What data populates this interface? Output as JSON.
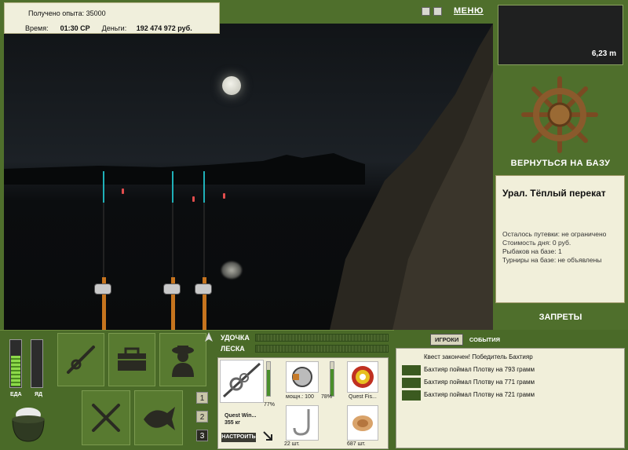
{
  "top": {
    "xp_label": "Получено опыта:",
    "xp_value": "35000",
    "time_label": "Время:",
    "time_value": "01:30 СР",
    "money_label": "Деньги:",
    "money_value": "192 474 972 руб.",
    "menu_label": "МЕНЮ",
    "icons": [
      "pause-icon",
      "sound-icon"
    ]
  },
  "right": {
    "depth": "6,23 m",
    "return_label": "ВЕРНУТЬСЯ НА БАЗУ",
    "location_title": "Урал. Тёплый перекат",
    "location_info": [
      "Осталось путевки: не ограничено",
      "Стоимость дня: 0 руб.",
      "Рыбаков на базе: 1",
      "Турниры на базе: не объявлены"
    ],
    "bans_label": "ЗАПРЕТЫ"
  },
  "bottom": {
    "food_label": "ЕДА",
    "poison_label": "ЯД",
    "food_level": 0.65,
    "poison_level": 0,
    "rod_label": "УДОЧКА",
    "line_label": "ЛЕСКА",
    "slots": [
      "1",
      "2",
      "3"
    ],
    "active_slot": "3"
  },
  "tackle": {
    "rod_name": "Quest Win...",
    "rod_weight": "355 кг",
    "rod_percent": "77%",
    "rod_level": 0.77,
    "reel_power": "мощн.: 100",
    "reel_percent": "78%",
    "reel_level": 0.78,
    "line_name": "Quest Fis...",
    "hooks": "22 шт.",
    "bait": "687 шт.",
    "adjust_label": "НАСТРОИТЬ"
  },
  "chat": {
    "tab_players": "ИГРОКИ",
    "tab_events": "СОБЫТИЯ",
    "messages": [
      "Квест закончен! Победитель Бахтияр",
      "Бахтияр поймал Плотву на 793 грамм",
      "Бахтияр поймал Плотву на 771 грамм",
      "Бахтияр поймал Плотву на 721 грамм"
    ]
  },
  "colors": {
    "panel": "#4f6f2c",
    "cream": "#f1efda",
    "rod_butt": "#c6741e",
    "rod_tip": "#1fb0b8"
  }
}
